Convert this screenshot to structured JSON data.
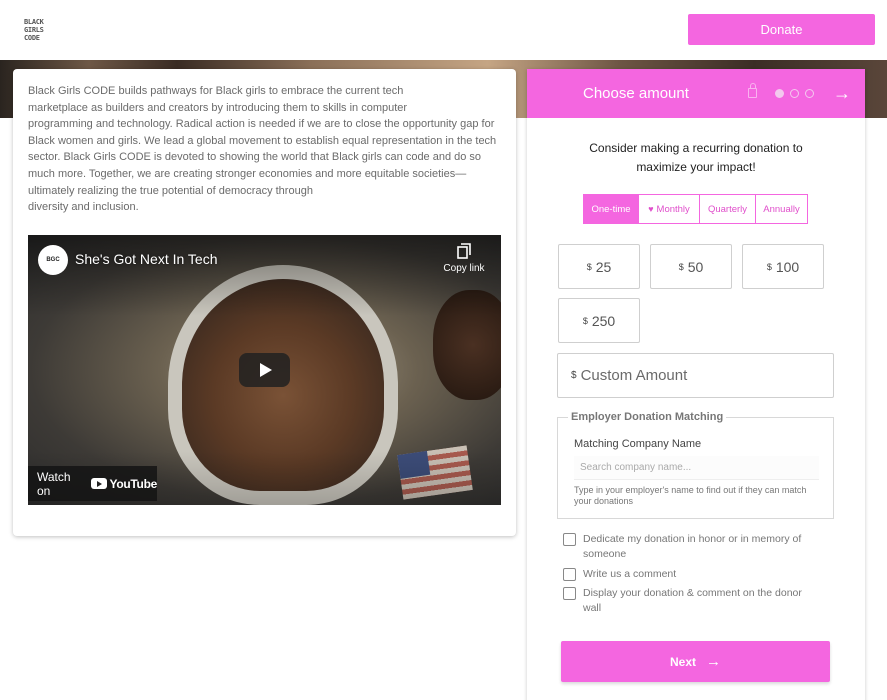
{
  "header": {
    "logo_lines": [
      "BLACK",
      "GIRLS",
      "CODE"
    ],
    "donate_label": "Donate"
  },
  "about": {
    "text_lines": [
      "Black Girls CODE builds pathways for Black girls to embrace the current tech",
      "marketplace as builders and creators by introducing them to skills in computer",
      "programming and technology. Radical action is needed if we are to close the opportunity gap for",
      "Black women and girls. We lead a global movement to establish equal representation in the tech",
      "sector. Black Girls CODE is devoted to showing the world that Black girls can code and do so",
      "much more. Together, we are creating stronger economies and more equitable societies—",
      "ultimately realizing the true potential of democracy through",
      "diversity and inclusion."
    ]
  },
  "video": {
    "title": "She's Got Next In Tech",
    "copy_link_label": "Copy link",
    "watch_on_label": "Watch on",
    "youtube_label": "YouTube"
  },
  "panel": {
    "title": "Choose amount",
    "intro": "Consider making a recurring donation to maximize your impact!",
    "frequency": [
      "One-time",
      "Monthly",
      "Quarterly",
      "Annually"
    ],
    "currency_symbol": "$",
    "amounts": [
      "25",
      "50",
      "100",
      "250"
    ],
    "custom_placeholder": "Custom Amount",
    "matching": {
      "legend": "Employer Donation Matching",
      "label": "Matching Company Name",
      "placeholder": "Search company name...",
      "hint": "Type in your employer's name to find out if they can match your donations"
    },
    "checkboxes": [
      "Dedicate my donation in honor or in memory of someone",
      "Write us a comment",
      "Display your donation & comment on the donor wall"
    ],
    "next_label": "Next"
  },
  "colors": {
    "accent": "#f466e0"
  },
  "icons": [
    "lock-icon",
    "arrow-right-icon",
    "heart-icon",
    "copy-icon",
    "play-icon",
    "youtube-icon"
  ]
}
